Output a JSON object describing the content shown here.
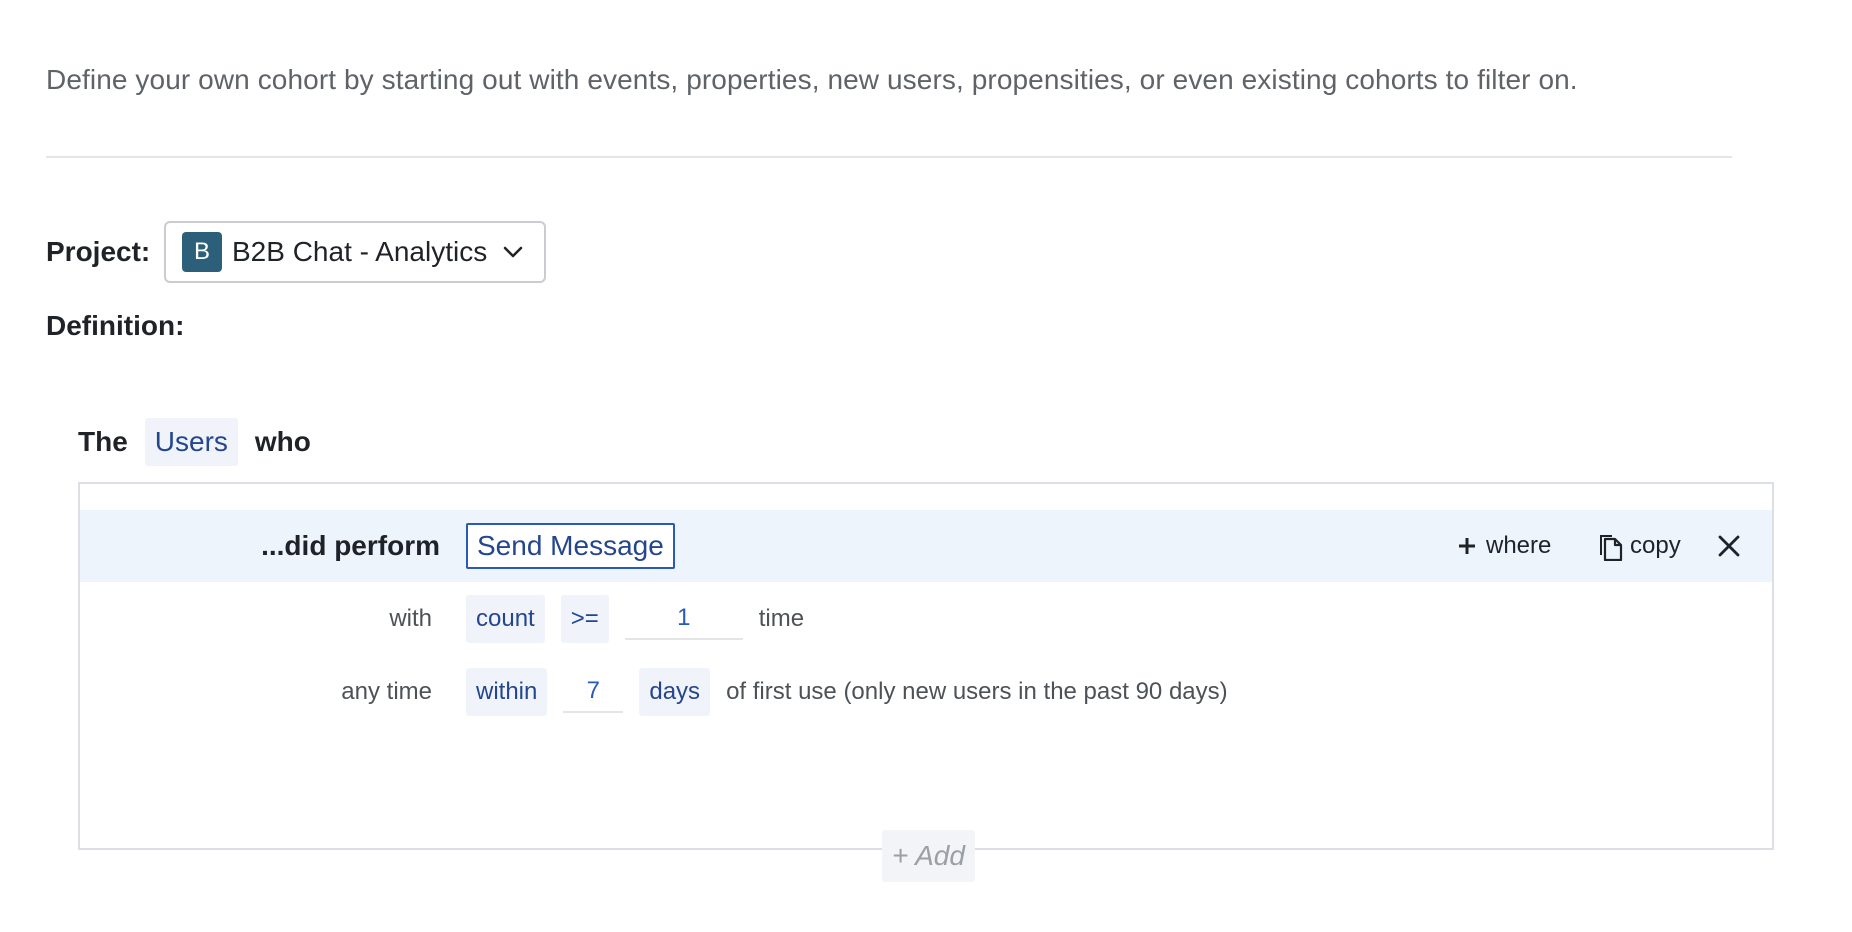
{
  "intro": {
    "text": "Define your own cohort by starting out with events, properties, new users, propensities, or even existing cohorts to filter on."
  },
  "project": {
    "label": "Project:",
    "avatar_letter": "B",
    "avatar_color": "#2c5f7a",
    "name": "B2B Chat - Analytics",
    "chevron_icon": "chevron-down-icon"
  },
  "definition": {
    "label": "Definition:"
  },
  "cohort": {
    "prefix": "The",
    "entity": "Users",
    "suffix": "who"
  },
  "condition": {
    "perform_label": "...did perform",
    "event": "Send Message",
    "actions": {
      "where_label": "where",
      "copy_label": "copy"
    },
    "count_row": {
      "label": "with",
      "metric": "count",
      "operator": ">=",
      "value": "1",
      "unit": "time"
    },
    "time_row": {
      "label": "any time",
      "mode": "within",
      "value": "7",
      "unit": "days",
      "suffix": "of first use (only new users in the past 90 days)"
    }
  },
  "add": {
    "label": "+ Add"
  },
  "colors": {
    "accent_blue": "#24468f",
    "token_bg": "#f0f4fa",
    "row_highlight": "#eef4fc",
    "border": "#dcdfe3"
  }
}
